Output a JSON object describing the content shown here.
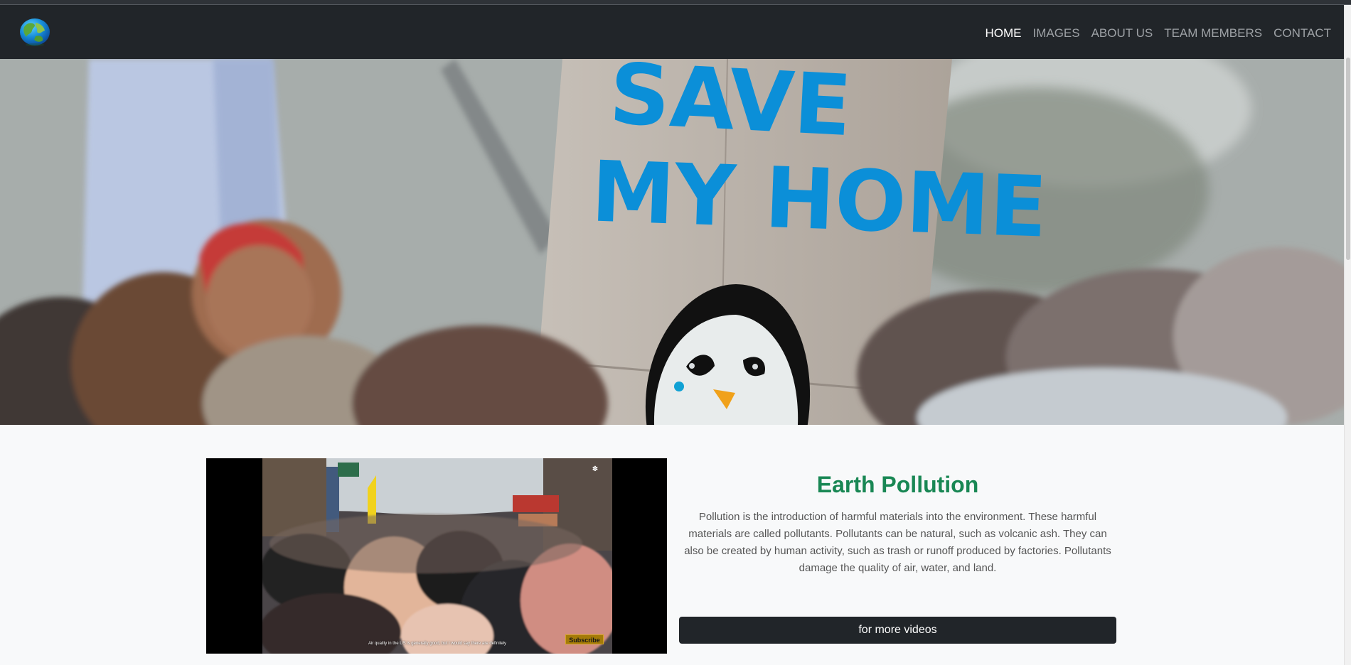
{
  "navigation": {
    "logo_icon": "earth-globe-icon",
    "items": [
      {
        "label": "HOME",
        "active": true
      },
      {
        "label": "IMAGES",
        "active": false
      },
      {
        "label": "ABOUT US",
        "active": false
      },
      {
        "label": "TEAM MEMBERS",
        "active": false
      },
      {
        "label": "CONTACT",
        "active": false
      }
    ]
  },
  "hero": {
    "image_text": "SAVE MY HOME"
  },
  "video": {
    "caption": "Air quality in the US is generally good, but I would say there are definitely",
    "subscribe_label": "Subscribe",
    "network_icon": "peacock-icon"
  },
  "article": {
    "title": "Earth Pollution",
    "body": "Pollution is the introduction of harmful materials into the environment. These harmful materials are called pollutants. Pollutants can be natural, such as volcanic ash. They can also be created by human activity, such as trash or runoff produced by factories. Pollutants damage the quality of air, water, and land.",
    "button_label": "for more videos"
  },
  "colors": {
    "navbar": "#212529",
    "accent": "#198754",
    "hero_text": "#0b8fd8"
  }
}
